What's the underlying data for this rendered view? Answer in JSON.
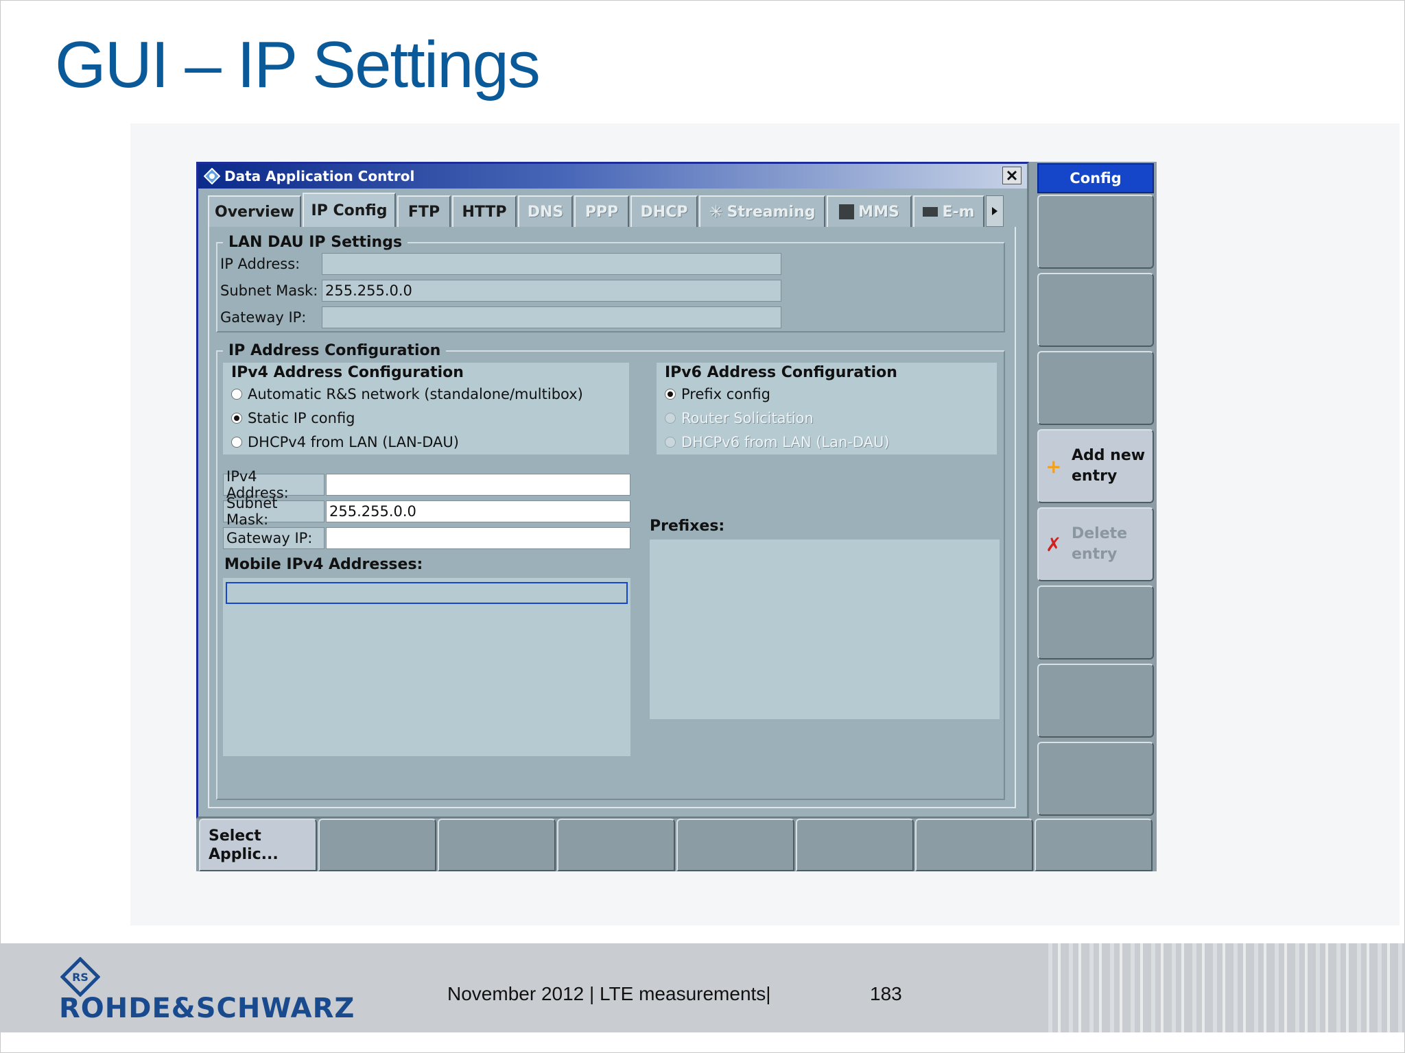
{
  "slide": {
    "title": "GUI – IP Settings",
    "footer_text": "November 2012 |  LTE measurements|",
    "page_number": "183",
    "brand": "ROHDE&SCHWARZ"
  },
  "window": {
    "title": "Data Application Control",
    "tabs": [
      {
        "label": "Overview",
        "state": "normal"
      },
      {
        "label": "IP Config",
        "state": "active"
      },
      {
        "label": "FTP",
        "state": "normal"
      },
      {
        "label": "HTTP",
        "state": "normal"
      },
      {
        "label": "DNS",
        "state": "disabled"
      },
      {
        "label": "PPP",
        "state": "disabled"
      },
      {
        "label": "DHCP",
        "state": "disabled"
      },
      {
        "label": "Streaming",
        "state": "disabled"
      },
      {
        "label": "MMS",
        "state": "disabled"
      },
      {
        "label": "E-m",
        "state": "disabled"
      }
    ]
  },
  "lan_dau": {
    "title": "LAN DAU IP Settings",
    "ip_label": "IP Address:",
    "ip_value": "",
    "mask_label": "Subnet Mask:",
    "mask_value": "255.255.0.0",
    "gateway_label": "Gateway IP:",
    "gateway_value": ""
  },
  "ip_config": {
    "title": "IP Address Configuration",
    "ipv4": {
      "title": "IPv4 Address Configuration",
      "options": [
        {
          "label": "Automatic R&S network (standalone/multibox)",
          "selected": false,
          "disabled": false
        },
        {
          "label": "Static IP config",
          "selected": true,
          "disabled": false
        },
        {
          "label": "DHCPv4 from LAN (LAN-DAU)",
          "selected": false,
          "disabled": false
        }
      ],
      "address_label": "IPv4 Address:",
      "address_value": "",
      "mask_label": "Subnet Mask:",
      "mask_value": "255.255.0.0",
      "gateway_label": "Gateway IP:",
      "gateway_value": "",
      "mobile_label": "Mobile IPv4 Addresses:"
    },
    "ipv6": {
      "title": "IPv6 Address Configuration",
      "options": [
        {
          "label": "Prefix config",
          "selected": true,
          "disabled": false
        },
        {
          "label": "Router Solicitation",
          "selected": false,
          "disabled": true
        },
        {
          "label": "DHCPv6 from LAN (Lan-DAU)",
          "selected": false,
          "disabled": true
        }
      ],
      "prefixes_label": "Prefixes:"
    }
  },
  "softkeys_right": {
    "header": "Config",
    "add_label_1": "Add new",
    "add_label_2": "entry",
    "delete_label_1": "Delete",
    "delete_label_2": "entry"
  },
  "softkeys_bottom": {
    "select_1": "Select",
    "select_2": "Applic..."
  },
  "colors": {
    "title_blue": "#0a5a9a",
    "brand_blue": "#1a4a8e",
    "softkey_header": "#1545c8",
    "panel": "#9bb0b9"
  }
}
